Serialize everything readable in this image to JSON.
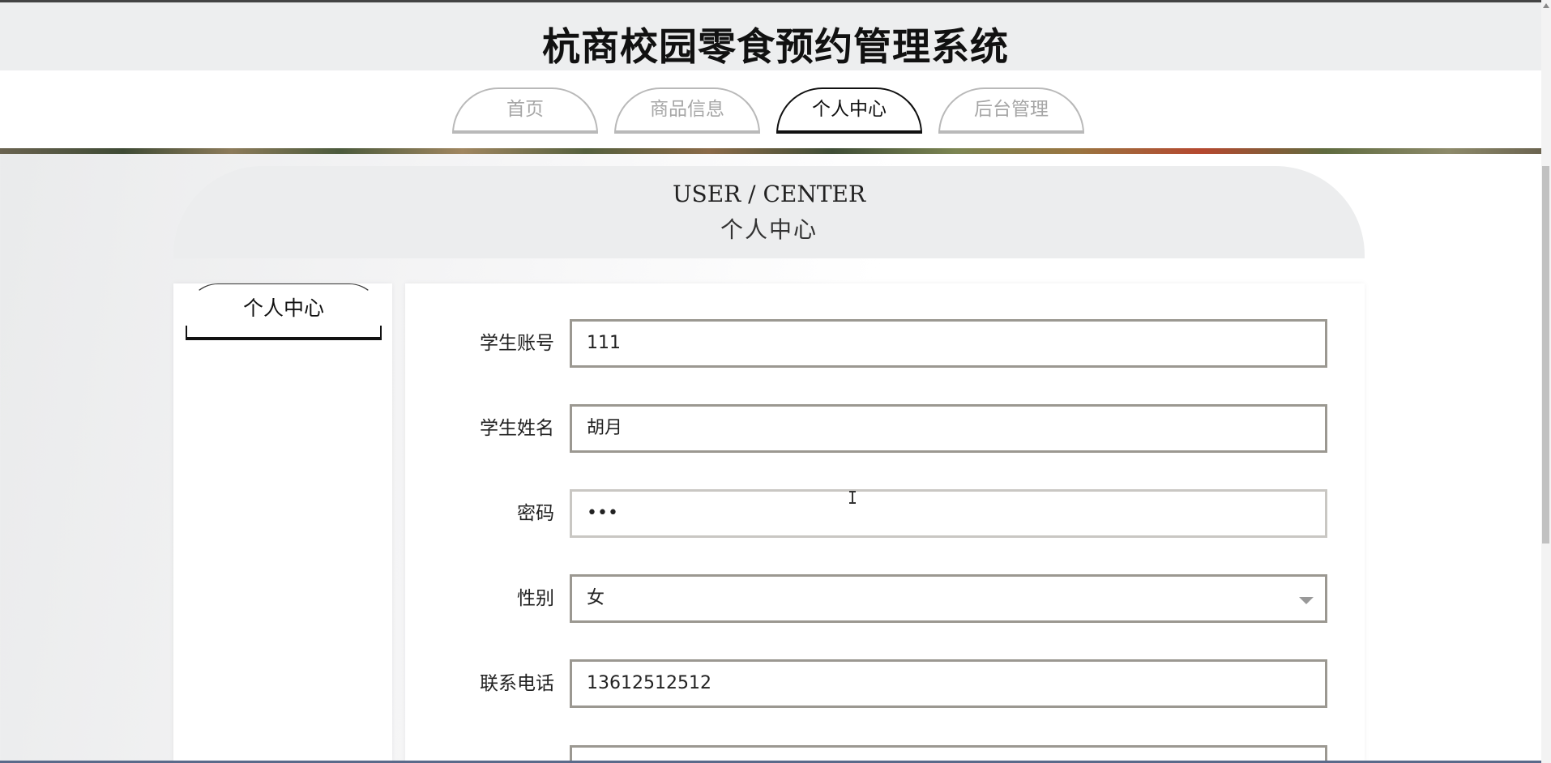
{
  "site": {
    "title": "杭商校园零食预约管理系统"
  },
  "nav": {
    "tabs": [
      {
        "label": "首页",
        "active": false
      },
      {
        "label": "商品信息",
        "active": false
      },
      {
        "label": "个人中心",
        "active": true
      },
      {
        "label": "后台管理",
        "active": false
      }
    ]
  },
  "banner": {
    "en": "USER / CENTER",
    "zh": "个人中心"
  },
  "sidebar": {
    "items": [
      {
        "label": "个人中心",
        "active": true
      }
    ]
  },
  "form": {
    "fields": [
      {
        "label": "学生账号",
        "value": "111"
      },
      {
        "label": "学生姓名",
        "value": "胡月"
      },
      {
        "label": "密码",
        "value": "•••"
      },
      {
        "label": "性别",
        "value": "女",
        "type": "select"
      },
      {
        "label": "联系电话",
        "value": "13612512512"
      }
    ]
  },
  "colors": {
    "accent": "#111111",
    "inactive": "#a6a6a6",
    "field_border": "#9b9891",
    "header_bg": "#edeeef"
  },
  "icons": {
    "select": "chevron-down-icon",
    "cursor": "text-cursor-icon"
  }
}
